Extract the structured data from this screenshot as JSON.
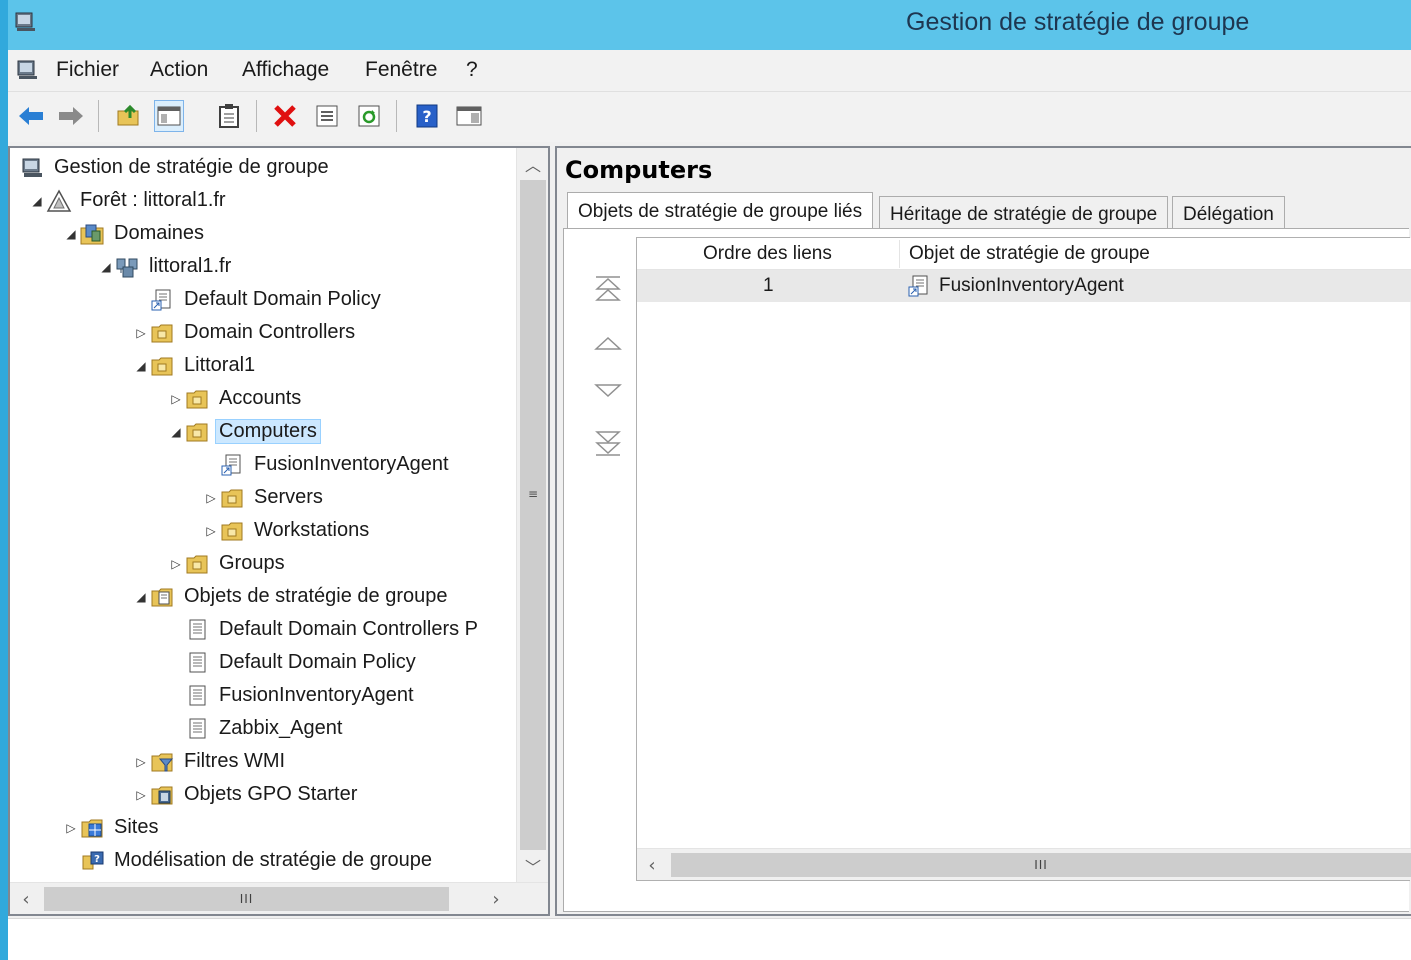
{
  "window": {
    "title": "Gestion de stratégie de groupe"
  },
  "menu": [
    "Fichier",
    "Action",
    "Affichage",
    "Fenêtre",
    "?"
  ],
  "toolbar": {
    "buttons": [
      "back-arrow-icon",
      "forward-arrow-icon",
      "up-folder-icon",
      "show-hide-tree-icon",
      "clipboard-icon",
      "delete-icon",
      "properties-icon",
      "refresh-icon",
      "help-icon",
      "action-pane-icon"
    ]
  },
  "tree": {
    "items": [
      {
        "label": "Gestion de stratégie de groupe",
        "icon": "gpmc-icon",
        "expander": ""
      },
      {
        "label": "Forêt : littoral1.fr",
        "icon": "forest-icon",
        "expander": "expanded"
      },
      {
        "label": "Domaines",
        "icon": "domains-folder-icon",
        "expander": "expanded"
      },
      {
        "label": "littoral1.fr",
        "icon": "domain-icon",
        "expander": "expanded"
      },
      {
        "label": "Default Domain Policy",
        "icon": "gpo-link-icon",
        "expander": ""
      },
      {
        "label": "Domain Controllers",
        "icon": "ou-folder-icon",
        "expander": "collapsed"
      },
      {
        "label": "Littoral1",
        "icon": "ou-folder-icon",
        "expander": "expanded"
      },
      {
        "label": "Accounts",
        "icon": "ou-folder-icon",
        "expander": "collapsed"
      },
      {
        "label": "Computers",
        "icon": "ou-folder-icon",
        "expander": "expanded"
      },
      {
        "label": "FusionInventoryAgent",
        "icon": "gpo-link-icon",
        "expander": ""
      },
      {
        "label": "Servers",
        "icon": "ou-folder-icon",
        "expander": "collapsed"
      },
      {
        "label": "Workstations",
        "icon": "ou-folder-icon",
        "expander": "collapsed"
      },
      {
        "label": "Groups",
        "icon": "ou-folder-icon",
        "expander": "collapsed"
      },
      {
        "label": "Objets de stratégie de groupe",
        "icon": "gpo-container-icon",
        "expander": "expanded"
      },
      {
        "label": "Default Domain Controllers P",
        "icon": "gpo-icon",
        "expander": ""
      },
      {
        "label": "Default Domain Policy",
        "icon": "gpo-icon",
        "expander": ""
      },
      {
        "label": "FusionInventoryAgent",
        "icon": "gpo-icon",
        "expander": ""
      },
      {
        "label": "Zabbix_Agent",
        "icon": "gpo-icon",
        "expander": ""
      },
      {
        "label": "Filtres WMI",
        "icon": "wmi-filter-icon",
        "expander": "collapsed"
      },
      {
        "label": "Objets GPO Starter",
        "icon": "starter-gpo-icon",
        "expander": "collapsed"
      },
      {
        "label": "Sites",
        "icon": "sites-icon",
        "expander": "collapsed"
      },
      {
        "label": "Modélisation de stratégie de groupe",
        "icon": "modeling-icon",
        "expander": ""
      }
    ],
    "selected": "Computers"
  },
  "content": {
    "heading": "Computers",
    "tabs": [
      "Objets de stratégie de groupe liés",
      "Héritage de stratégie de groupe",
      "Délégation"
    ],
    "active_tab": "Objets de stratégie de groupe liés",
    "grid": {
      "columns": [
        "Ordre des liens",
        "Objet de stratégie de groupe"
      ],
      "rows": [
        {
          "order": "1",
          "gpo": "FusionInventoryAgent"
        }
      ]
    }
  },
  "scrollbar_grip": "III"
}
